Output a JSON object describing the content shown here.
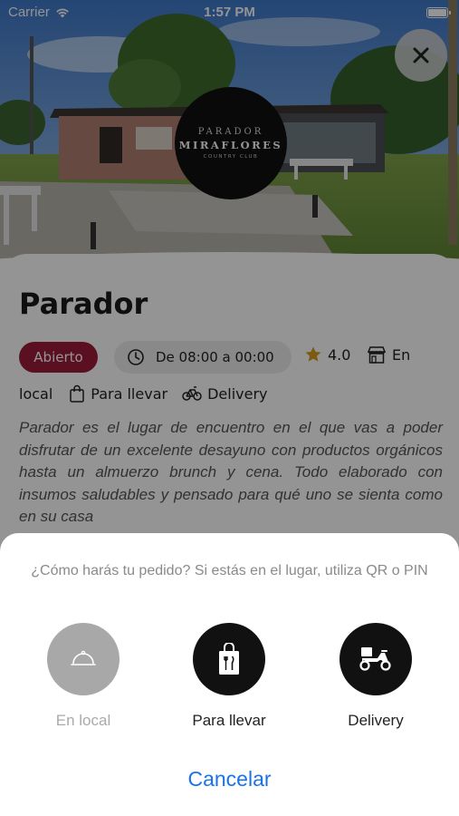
{
  "status_bar": {
    "carrier": "Carrier",
    "time": "1:57 PM"
  },
  "logo": {
    "line1": "PARADOR",
    "line2": "MIRAFLORES",
    "line3": "COUNTRY CLUB"
  },
  "venue": {
    "title": "Parador",
    "status_badge": "Abierto",
    "hours": "De 08:00 a 00:00",
    "rating": "4.0",
    "services": {
      "local_part1": "En",
      "local_part2": "local",
      "takeaway": "Para llevar",
      "delivery": "Delivery"
    },
    "description": "Parador es el lugar de encuentro en el que vas a poder disfrutar de un excelente desayuno con productos orgánicos hasta un almuerzo brunch y cena. Todo elaborado con insumos saludables y pensado para qué uno se sienta como en su casa"
  },
  "sheet": {
    "prompt": "¿Cómo harás tu pedido? Si estás en el lugar, utiliza QR o PIN",
    "options": [
      {
        "label": "En local",
        "enabled": false,
        "icon": "cloche-icon"
      },
      {
        "label": "Para llevar",
        "enabled": true,
        "icon": "takeaway-bag-icon"
      },
      {
        "label": "Delivery",
        "enabled": true,
        "icon": "delivery-scooter-icon"
      }
    ],
    "cancel_label": "Cancelar"
  },
  "colors": {
    "badge": "#9b1c3a",
    "link": "#1a73e8",
    "star": "#d99a1e"
  }
}
